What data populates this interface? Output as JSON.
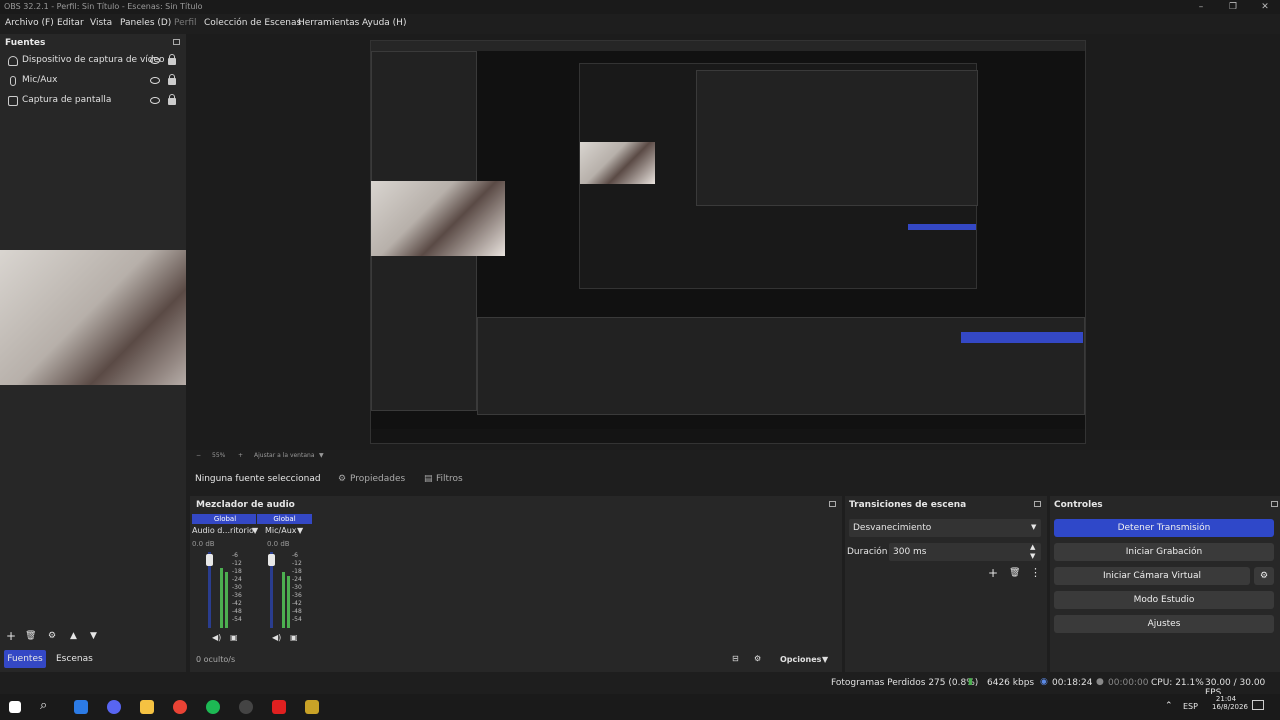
{
  "window": {
    "title": "OBS 32.2.1 - Perfil: Sin Título - Escenas: Sin Título"
  },
  "menu": [
    {
      "label": "Archivo (F)",
      "dim": false
    },
    {
      "label": "Editar",
      "dim": false
    },
    {
      "label": "Vista",
      "dim": false
    },
    {
      "label": "Paneles (D)",
      "dim": false
    },
    {
      "label": "Perfil",
      "dim": true
    },
    {
      "label": "Colección de Escenas",
      "dim": false
    },
    {
      "label": "Herramientas",
      "dim": false
    },
    {
      "label": "Ayuda (H)",
      "dim": false
    }
  ],
  "sources": {
    "title": "Fuentes",
    "items": [
      {
        "label": "Dispositivo de captura de vídeo",
        "icon": "camera-icon"
      },
      {
        "label": "Mic/Aux",
        "icon": "mic-icon"
      },
      {
        "label": "Captura de pantalla",
        "icon": "monitor-icon"
      }
    ],
    "tabs": {
      "sources": "Fuentes",
      "scenes": "Escenas"
    }
  },
  "zoom": {
    "level": "55%",
    "fit": "Ajustar a la ventana"
  },
  "context": {
    "no_source": "Ninguna fuente seleccionad",
    "properties": "Propiedades",
    "filters": "Filtros"
  },
  "mixer": {
    "title": "Mezclador de audio",
    "global": "Global",
    "channels": [
      {
        "name": "Audio d...ritorio",
        "db": "0.0 dB"
      },
      {
        "name": "Mic/Aux",
        "db": "0.0 dB"
      }
    ],
    "ticks": [
      "-6",
      "-12",
      "-18",
      "-24",
      "-30",
      "-36",
      "-42",
      "-48",
      "-54"
    ],
    "hidden": "0 oculto/s",
    "options": "Opciones"
  },
  "transitions": {
    "title": "Transiciones de escena",
    "selected": "Desvanecimiento",
    "duration_label": "Duración",
    "duration_value": "300 ms"
  },
  "controls": {
    "title": "Controles",
    "stop_stream": "Detener Transmisión",
    "start_recording": "Iniciar Grabación",
    "start_virtual_cam": "Iniciar Cámara Virtual",
    "studio_mode": "Modo Estudio",
    "settings": "Ajustes"
  },
  "status": {
    "dropped": "Fotogramas Perdidos 275 (0.8%)",
    "bitrate": "6426 kbps",
    "stream_time": "00:18:24",
    "rec_time": "00:00:00",
    "cpu": "CPU: 21.1%",
    "fps": "30.00 / 30.00 FPS"
  },
  "taskbar": {
    "lang": "ESP",
    "time": "21:04",
    "date": "16/8/2026"
  },
  "colors": {
    "accent": "#2f48c9",
    "bg": "#1e1e1e",
    "panel": "#272727"
  }
}
